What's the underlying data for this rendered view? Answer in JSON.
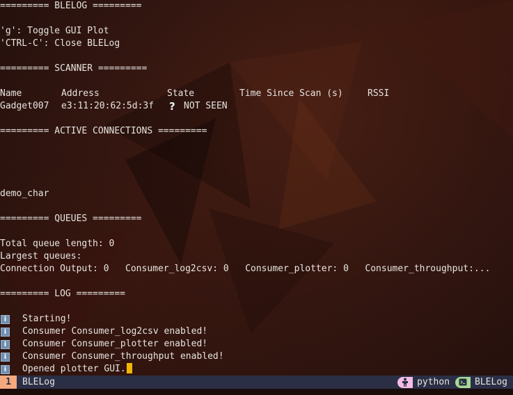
{
  "terminal": {
    "header_blelog": "========= BLELOG =========",
    "help_toggle": "'g': Toggle GUI Plot",
    "help_close": "'CTRL-C': Close BLELog",
    "header_scanner": "========= SCANNER =========",
    "scanner": {
      "columns": [
        "Name",
        "Address",
        "State",
        "Time Since Scan (s)",
        "RSSI"
      ],
      "rows": [
        {
          "name": "Gadget007",
          "address": "e3:11:20:62:5d:3f",
          "state_icon": "question-mark-icon",
          "state_glyph": "?",
          "state": "NOT SEEN"
        }
      ]
    },
    "header_connections": "========= ACTIVE CONNECTIONS =========",
    "characteristic": "demo_char",
    "header_queues": "========= QUEUES =========",
    "total_queue": "Total queue length: 0",
    "largest_queues_label": "Largest queues:",
    "queues_line": "Connection Output: 0   Consumer_log2csv: 0   Consumer_plotter: 0   Consumer_throughput:...",
    "header_log": "========= LOG =========",
    "log_icon_glyph": "i",
    "log": [
      "Starting!",
      "Consumer Consumer_log2csv enabled!",
      "Consumer Consumer_plotter enabled!",
      "Consumer Consumer_throughput enabled!",
      "Opened plotter GUI."
    ]
  },
  "statusbar": {
    "window_index": "1",
    "window_name": "BLELog",
    "process_icon": "person-icon",
    "process": "python",
    "session_icon": "terminal-icon",
    "session": "BLELog"
  },
  "colors": {
    "accent_orange": "#f5a97f",
    "cursor_yellow": "#f2b705",
    "pill_pink": "#f5bde6",
    "pill_green": "#a6da95",
    "statusbar_bg": "#2a2f45"
  }
}
